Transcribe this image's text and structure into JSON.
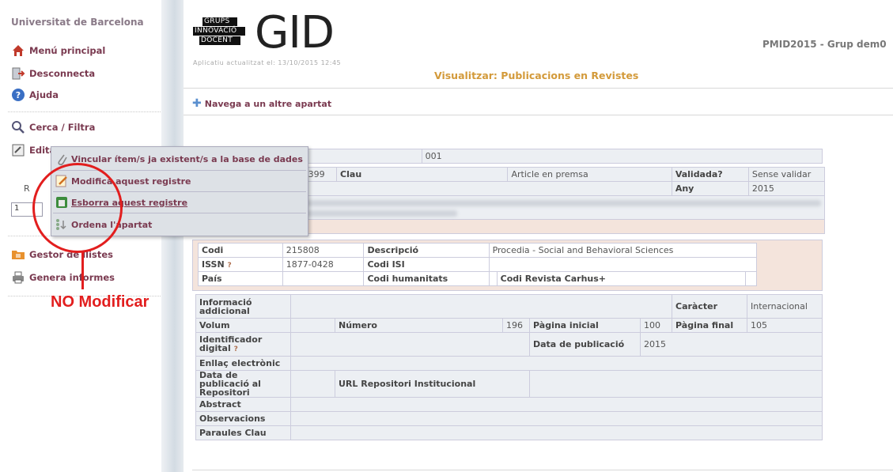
{
  "sidebar": {
    "title": "Universitat de Barcelona",
    "items": [
      {
        "label": "Menú principal"
      },
      {
        "label": "Desconnecta"
      },
      {
        "label": "Ajuda"
      },
      {
        "label": "Cerca / Filtra"
      },
      {
        "label": "Edita"
      },
      {
        "label": "Gestor de llistes"
      },
      {
        "label": "Genera informes"
      }
    ],
    "small_label": "R",
    "input_value": "1"
  },
  "header": {
    "logo_lines": [
      "GRUPS",
      "INNOVACIÓ",
      "DOCENT"
    ],
    "logo_big": "GID",
    "updated": "Aplicatiu actualitzat el: 13/10/2015 12:45",
    "right_title": "PMID2015 - Grup dem0",
    "page_heading": "Visualitzar: Publicacions en Revistes",
    "nav_link": "Navega a un altre apartat"
  },
  "popup": {
    "items": [
      {
        "label": "Vincular ítem/s ja existent/s a la base de dades",
        "icon": "paperclip-icon"
      },
      {
        "label": "Modifica aquest registre",
        "icon": "edit-icon"
      },
      {
        "label": "Esborra aquest registre",
        "icon": "delete-icon"
      },
      {
        "label": "Ordena l'apartat",
        "icon": "sort-icon"
      }
    ]
  },
  "annotation": {
    "text": "NO Modificar",
    "color": "#e21e1e"
  },
  "record": {
    "top_code": "001",
    "id_tail": "399",
    "clau_label": "Clau",
    "clau_value": "Article en premsa",
    "validada_label": "Validada?",
    "validada_value": "Sense validar",
    "any_label": "Any",
    "any_value": "2015",
    "codi_label": "Codi",
    "codi_value": "215808",
    "descripcio_label": "Descripció",
    "descripcio_value": "Procedia - Social and Behavioral Sciences",
    "issn_label": "ISSN",
    "issn_help": "?",
    "issn_value": "1877-0428",
    "codi_isi_label": "Codi ISI",
    "pais_label": "País",
    "codi_hum_label": "Codi humanitats",
    "codi_carhus_label": "Codi Revista Carhus+",
    "info_label": "Informació addicional",
    "caracter_label": "Caràcter",
    "caracter_value": "Internacional",
    "volum_label": "Volum",
    "numero_label": "Número",
    "numero_value": "196",
    "pag_ini_label": "Pàgina inicial",
    "pag_ini_value": "100",
    "pag_fin_label": "Pàgina final",
    "pag_fin_value": "105",
    "ident_label": "Identificador digital",
    "ident_help": "?",
    "data_pub_label": "Data de publicació",
    "data_pub_value": "2015",
    "enllac_label": "Enllaç electrònic",
    "data_rep_label": "Data de publicació al Repositori",
    "url_rep_label": "URL Repositori Institucional",
    "abstract_label": "Abstract",
    "obs_label": "Observacions",
    "paraules_label": "Paraules Clau"
  }
}
